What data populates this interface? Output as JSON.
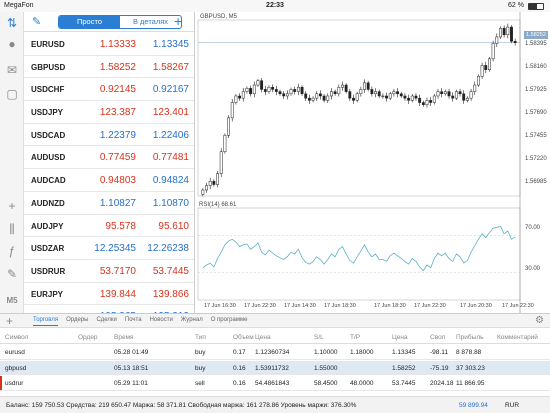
{
  "status": {
    "carrier": "MegaFon",
    "time": "22:33",
    "battery": "62 %"
  },
  "sidebar": {
    "m5_label": "M5"
  },
  "watch": {
    "tab_simple": "Просто",
    "tab_details": "В деталях",
    "rows": [
      {
        "symbol": "EURUSD",
        "bid": "1.13333",
        "ask": "1.13345",
        "bid_color": "red",
        "ask_color": "blue"
      },
      {
        "symbol": "GBPUSD",
        "bid": "1.58252",
        "ask": "1.58267",
        "bid_color": "red",
        "ask_color": "red"
      },
      {
        "symbol": "USDCHF",
        "bid": "0.92145",
        "ask": "0.92167",
        "bid_color": "red",
        "ask_color": "blue"
      },
      {
        "symbol": "USDJPY",
        "bid": "123.387",
        "ask": "123.401",
        "bid_color": "red",
        "ask_color": "red"
      },
      {
        "symbol": "USDCAD",
        "bid": "1.22379",
        "ask": "1.22406",
        "bid_color": "blue",
        "ask_color": "blue"
      },
      {
        "symbol": "AUDUSD",
        "bid": "0.77459",
        "ask": "0.77481",
        "bid_color": "red",
        "ask_color": "red"
      },
      {
        "symbol": "AUDCAD",
        "bid": "0.94803",
        "ask": "0.94824",
        "bid_color": "red",
        "ask_color": "blue"
      },
      {
        "symbol": "AUDNZD",
        "bid": "1.10827",
        "ask": "1.10870",
        "bid_color": "blue",
        "ask_color": "blue"
      },
      {
        "symbol": "AUDJPY",
        "bid": "95.578",
        "ask": "95.610",
        "bid_color": "red",
        "ask_color": "red"
      },
      {
        "symbol": "USDZAR",
        "bid": "12.25345",
        "ask": "12.26238",
        "bid_color": "blue",
        "ask_color": "blue"
      },
      {
        "symbol": "USDRUR",
        "bid": "53.7170",
        "ask": "53.7445",
        "bid_color": "red",
        "ask_color": "red"
      },
      {
        "symbol": "EURJPY",
        "bid": "139.844",
        "ask": "139.866",
        "bid_color": "red",
        "ask_color": "red"
      },
      {
        "symbol": "GBPJPY",
        "bid": "195.265",
        "ask": "195.312",
        "bid_color": "blue",
        "ask_color": "blue"
      }
    ]
  },
  "chart": {
    "title": "GBPUSD, M5",
    "rsi_title": "RSI(14) 68.61",
    "current_price": "1.58252",
    "price_labels": [
      "1.58395",
      "1.58160",
      "1.57925",
      "1.57690",
      "1.57455",
      "1.57220",
      "1.56985"
    ],
    "rsi_labels": [
      "70.00",
      "30.00"
    ],
    "x_labels": [
      "17 Jun 16:30",
      "17 Jun 22:30",
      "17 Jun 14:30",
      "17 Jun 18:30",
      "17 Jun 18:30",
      "17 Jun 22:30",
      "17 Jun 20:30",
      "17 Jun 22:30"
    ],
    "colors": {
      "candle": "#222222",
      "rsi": "#5fb0c8",
      "price_line": "#8aaac8"
    }
  },
  "chart_data": {
    "type": "candlestick",
    "price_axis": [
      "1.56985",
      "1.57220",
      "1.57455",
      "1.57690",
      "1.57925",
      "1.58160",
      "1.58395"
    ],
    "ylim": [
      1.5685,
      1.5846
    ],
    "rsi_axis": [
      "30.00",
      "70.00"
    ],
    "rsi_ylim": [
      0,
      100
    ],
    "close": [
      1.56905,
      1.56945,
      1.56985,
      1.56955,
      1.57055,
      1.57255,
      1.57405,
      1.57565,
      1.57705,
      1.57765,
      1.57745,
      1.57805,
      1.57835,
      1.57785,
      1.57865,
      1.57905,
      1.57825,
      1.57805,
      1.57845,
      1.57825,
      1.57805,
      1.57785,
      1.57765,
      1.57785,
      1.57825,
      1.57805,
      1.57845,
      1.57785,
      1.57745,
      1.57725,
      1.57745,
      1.57785,
      1.57765,
      1.57725,
      1.57765,
      1.57805,
      1.57785,
      1.57845,
      1.57865,
      1.57805,
      1.57745,
      1.57725,
      1.57785,
      1.57825,
      1.57885,
      1.57825,
      1.57785,
      1.57805,
      1.57765,
      1.57765,
      1.57745,
      1.57785,
      1.57805,
      1.57785,
      1.57765,
      1.57745,
      1.57725,
      1.57765,
      1.57745,
      1.57705,
      1.57685,
      1.57725,
      1.57705,
      1.57765,
      1.57805,
      1.57785,
      1.57805,
      1.57765,
      1.57745,
      1.57805,
      1.57785,
      1.57725,
      1.57745,
      1.57805,
      1.57865,
      1.57945,
      1.58045,
      1.58005,
      1.58105,
      1.58245,
      1.58305,
      1.58385,
      1.58325,
      1.58395,
      1.58265,
      1.58252
    ],
    "rsi": [
      35,
      38,
      40,
      36,
      45,
      52,
      60,
      64,
      66,
      63,
      58,
      60,
      61,
      55,
      58,
      62,
      52,
      49,
      54,
      51,
      48,
      46,
      44,
      47,
      52,
      50,
      55,
      46,
      41,
      39,
      42,
      47,
      44,
      39,
      44,
      50,
      47,
      55,
      58,
      50,
      43,
      40,
      47,
      53,
      60,
      52,
      47,
      50,
      44,
      44,
      42,
      48,
      51,
      48,
      45,
      42,
      39,
      45,
      42,
      36,
      32,
      38,
      35,
      45,
      51,
      48,
      51,
      45,
      42,
      50,
      47,
      40,
      43,
      52,
      59,
      66,
      72,
      68,
      73,
      78,
      79,
      80,
      72,
      75,
      66,
      68.61
    ]
  },
  "bottom": {
    "tabs": [
      "Торговля",
      "Ордеры",
      "Сделки",
      "Почта",
      "Новости",
      "Журнал",
      "О программе"
    ],
    "headers": [
      "Символ",
      "Ордер",
      "Время",
      "Тип",
      "Объем",
      "Цена",
      "S/L",
      "T/P",
      "Цена",
      "Своп",
      "Прибыль",
      "Комментарий"
    ],
    "rows": [
      {
        "symbol": "eurusd",
        "time": "05.28 01:49",
        "type": "buy",
        "volume": "0.17",
        "price": "1.12360734",
        "sl": "1.10000",
        "tp": "1.18000",
        "cur": "1.13345",
        "swap": "-98.11",
        "profit": "8 878.88"
      },
      {
        "symbol": "gbpusd",
        "time": "05.13 18:51",
        "type": "buy",
        "volume": "0.16",
        "price": "1.53911732",
        "sl": "1.55000",
        "tp": "",
        "cur": "1.58252",
        "swap": "-75.19",
        "profit": "37 303.23"
      },
      {
        "symbol": "usdrur",
        "time": "05.29 11:01",
        "type": "sell",
        "volume": "0.16",
        "price": "54.4861843",
        "sl": "58.4500",
        "tp": "48.0000",
        "cur": "53.7445",
        "swap": "2024.18",
        "profit": "11 866.95"
      }
    ],
    "balance": "Баланс: 159 750.53 Средства: 219 650.47 Маржа: 58 371.81 Свободная маржа: 161 278.86 Уровень маржи: 376.30%",
    "total": "59 899.94",
    "currency": "RUR"
  }
}
